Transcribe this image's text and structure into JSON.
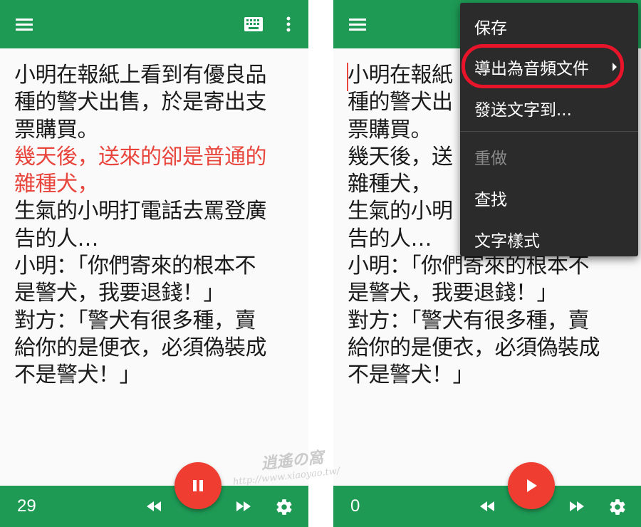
{
  "left": {
    "lines": [
      {
        "text": "小明在報紙上看到有優良品",
        "red": false
      },
      {
        "text": "種的警犬出售，於是寄出支",
        "red": false
      },
      {
        "text": "票購買。",
        "red": false
      },
      {
        "text": "幾天後，送來的卻是普通的",
        "red": true
      },
      {
        "text": "雜種犬，",
        "red": true
      },
      {
        "text": "生氣的小明打電話去罵登廣",
        "red": false
      },
      {
        "text": "告的人…",
        "red": false
      },
      {
        "text": "小明：「你們寄來的根本不",
        "red": false
      },
      {
        "text": "是警犬，我要退錢！」",
        "red": false
      },
      {
        "text": "對方：「警犬有很多種，賣",
        "red": false
      },
      {
        "text": "給你的是便衣，必須偽裝成",
        "red": false
      },
      {
        "text": "不是警犬！」",
        "red": false
      }
    ],
    "counter": "29",
    "fab_state": "pause"
  },
  "right": {
    "lines": [
      {
        "text": "小明在報紙"
      },
      {
        "text": "種的警犬出"
      },
      {
        "text": "票購買。"
      },
      {
        "text": "幾天後，送"
      },
      {
        "text": "雜種犬，"
      },
      {
        "text": "生氣的小明"
      },
      {
        "text": "告的人…"
      },
      {
        "text": "小明：「你們寄來的根本不"
      },
      {
        "text": "是警犬，我要退錢！」"
      },
      {
        "text": "對方：「警犬有很多種，賣"
      },
      {
        "text": "給你的是便衣，必須偽裝成"
      },
      {
        "text": "不是警犬！」"
      }
    ],
    "counter": "0",
    "fab_state": "play"
  },
  "menu": {
    "items": [
      {
        "label": "保存",
        "disabled": false
      },
      {
        "label": "導出為音頻文件",
        "disabled": false,
        "has_submenu": true,
        "highlighted": true
      },
      {
        "label": "發送文字到...",
        "disabled": false
      },
      {
        "label": "重做",
        "disabled": true
      },
      {
        "label": "查找",
        "disabled": false
      },
      {
        "label": "文字樣式",
        "disabled": false
      }
    ]
  },
  "watermark": {
    "logo": "逍遙の窩",
    "url": "http://www.xiaoyao.tw/"
  },
  "icons": {
    "menu": "hamburger-menu-icon",
    "keyboard": "keyboard-icon",
    "overflow": "more-vert-icon",
    "rewind": "rewind-icon",
    "forward": "fast-forward-icon",
    "settings": "gear-icon",
    "pause": "pause-icon",
    "play": "play-icon"
  },
  "colors": {
    "bar": "#1e9a55",
    "fab": "#ef3d31",
    "highlight_text": "#e8453c",
    "menu_bg": "#2b2b2b",
    "annotation_ring": "#e8142a"
  }
}
